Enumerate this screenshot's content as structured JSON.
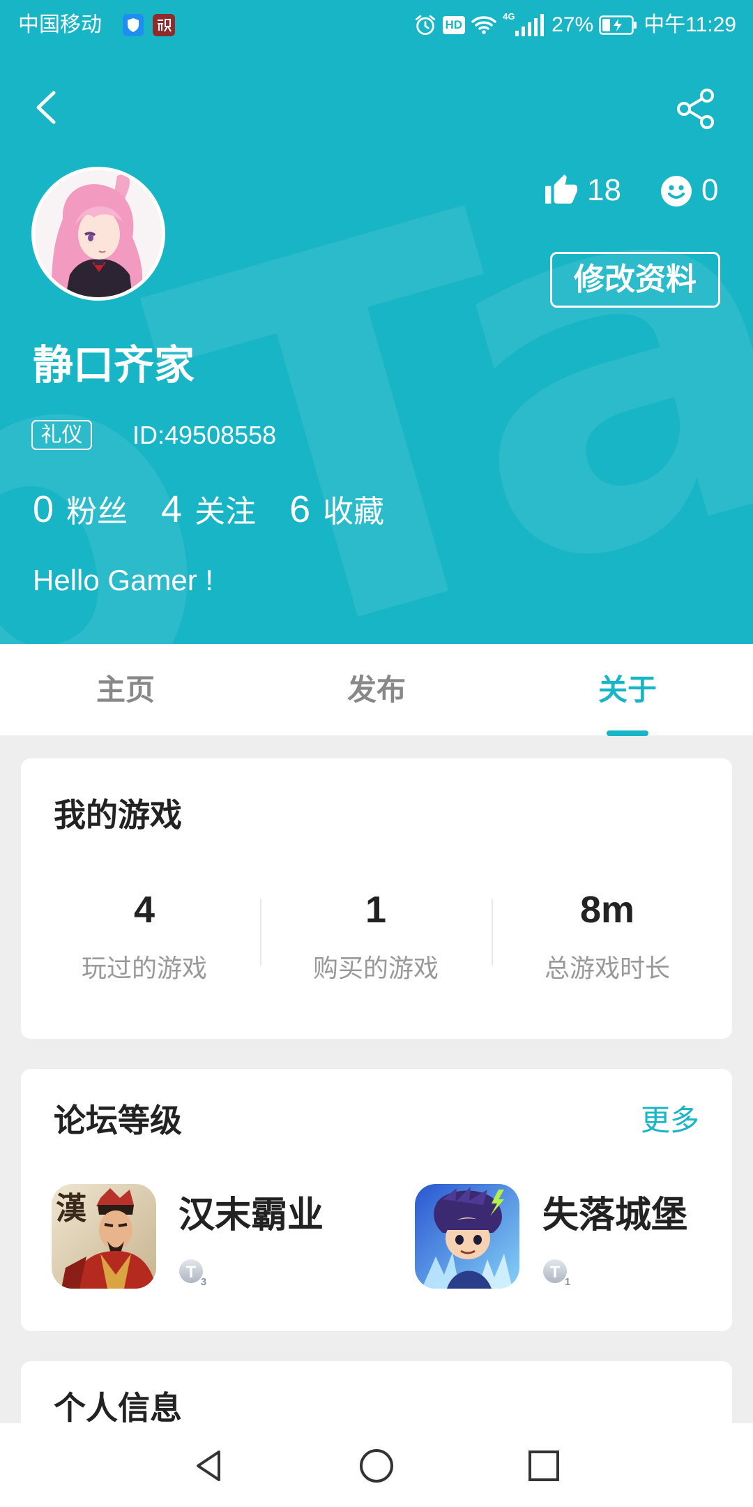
{
  "status_bar": {
    "carrier": "中国移动",
    "hd": "HD",
    "network": "4G",
    "battery": "27%",
    "time": "中午11:29",
    "icons": [
      "shield-icon",
      "app-notification-icon",
      "alarm-icon",
      "wifi-icon",
      "signal-icon",
      "battery-charging-icon"
    ]
  },
  "header": {
    "watermark": "TapTap",
    "likes": "18",
    "smiles": "0",
    "edit_button": "修改资料",
    "username": "静口齐家",
    "badge": "礼仪",
    "user_id": "ID:49508558",
    "stats": [
      {
        "value": "0",
        "label": "粉丝"
      },
      {
        "value": "4",
        "label": "关注"
      },
      {
        "value": "6",
        "label": "收藏"
      }
    ],
    "bio": "Hello Gamer !",
    "icons": [
      "back-arrow-icon",
      "share-icon",
      "thumbs-up-icon",
      "smiley-icon"
    ]
  },
  "tabs": [
    {
      "label": "主页",
      "active": false
    },
    {
      "label": "发布",
      "active": false
    },
    {
      "label": "关于",
      "active": true
    }
  ],
  "my_games": {
    "title": "我的游戏",
    "stats": [
      {
        "value": "4",
        "label": "玩过的游戏"
      },
      {
        "value": "1",
        "label": "购买的游戏"
      },
      {
        "value": "8m",
        "label": "总游戏时长"
      }
    ]
  },
  "forum_level": {
    "title": "论坛等级",
    "more": "更多",
    "games": [
      {
        "name": "汉末霸业",
        "icon_glyph": "漢",
        "level_prefix": "T",
        "level": "3"
      },
      {
        "name": "失落城堡",
        "level_prefix": "T",
        "level": "1"
      }
    ]
  },
  "personal_info": {
    "title": "个人信息"
  },
  "navbar": {
    "icons": [
      "nav-back-icon",
      "nav-home-icon",
      "nav-recents-icon"
    ]
  },
  "colors": {
    "accent": "#17b5c6",
    "background": "#eeeeee",
    "card": "#ffffff",
    "muted_text": "#999999"
  }
}
